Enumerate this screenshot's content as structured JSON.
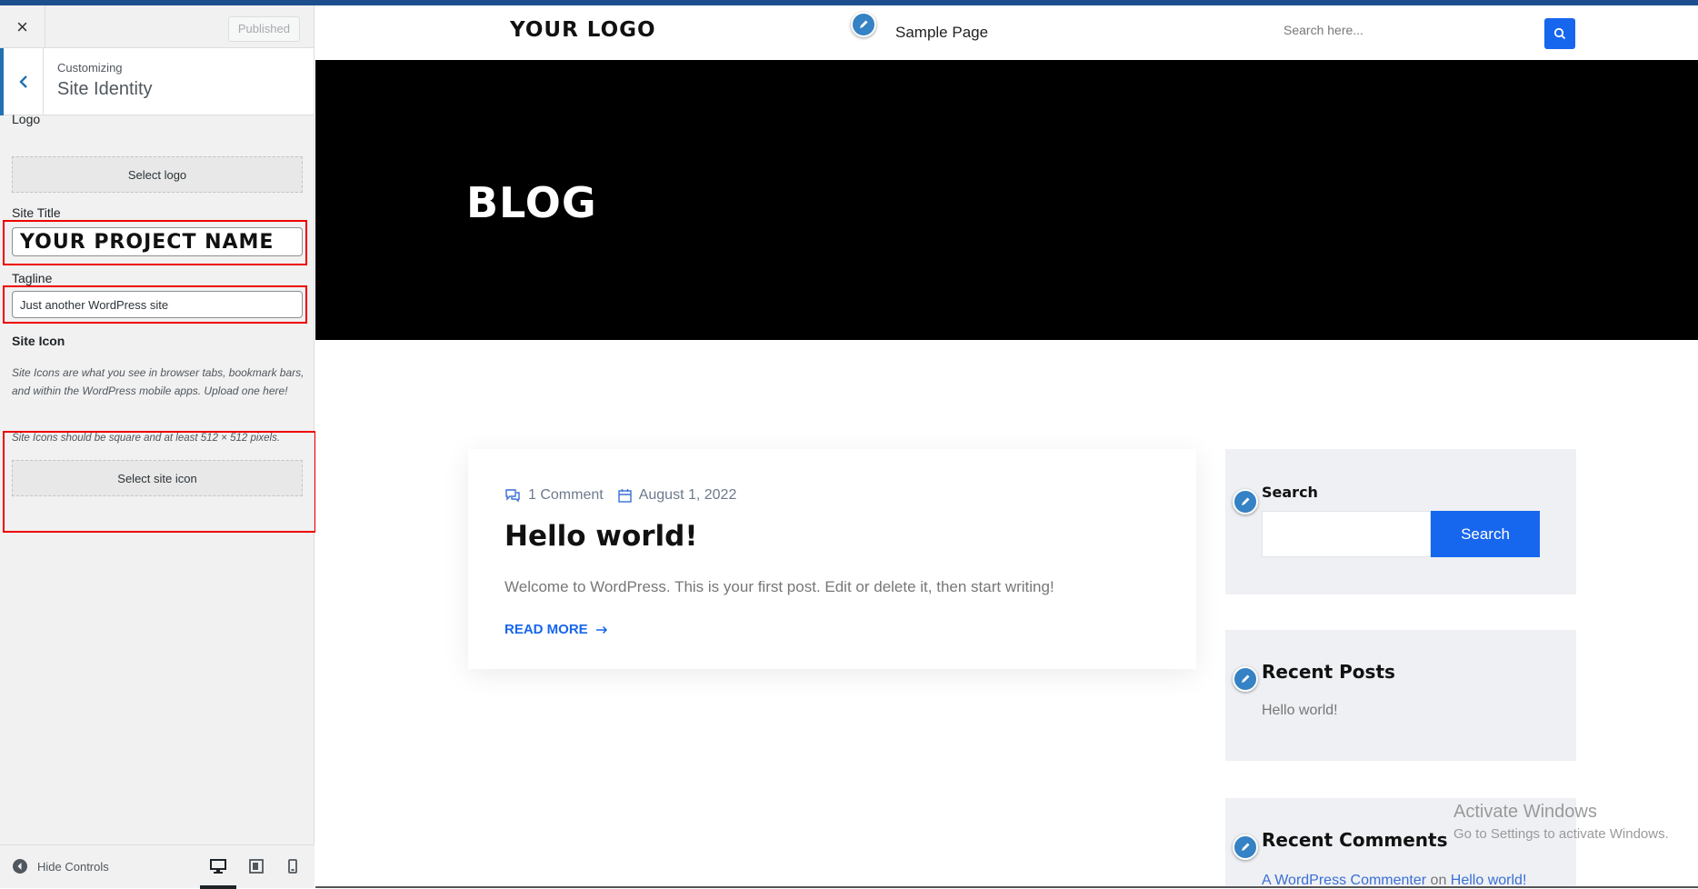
{
  "customizer": {
    "close_icon": "×",
    "publish_label": "Published",
    "section": {
      "breadcrumb": "Customizing",
      "title": "Site Identity"
    },
    "logo": {
      "label": "Logo",
      "button": "Select logo"
    },
    "site_title": {
      "label": "Site Title",
      "value": "YOUR PROJECT NAME"
    },
    "tagline": {
      "label": "Tagline",
      "value": "Just another WordPress site"
    },
    "site_icon": {
      "label": "Site Icon",
      "description": "Site Icons are what you see in browser tabs, bookmark bars, and within the WordPress mobile apps. Upload one here!",
      "note": "Site Icons should be square and at least 512 × 512 pixels.",
      "button": "Select site icon"
    },
    "footer": {
      "hide_controls": "Hide Controls",
      "devices": [
        "desktop-icon",
        "tablet-icon",
        "mobile-icon"
      ],
      "active_device": "desktop"
    },
    "highlight_color": "#ee0000"
  },
  "preview": {
    "header": {
      "logo": "YOUR LOGO",
      "nav": [
        "Sample Page"
      ],
      "search_placeholder": "Search here..."
    },
    "hero": {
      "title": "BLOG"
    },
    "post": {
      "comments": "1 Comment",
      "date": "August 1, 2022",
      "title": "Hello world!",
      "excerpt": "Welcome to WordPress. This is your first post. Edit or delete it, then start writing!",
      "read_more": "READ MORE"
    },
    "sidebar": {
      "search_widget": {
        "title": "Search",
        "button": "Search"
      },
      "recent_posts": {
        "title": "Recent Posts",
        "items": [
          "Hello world!"
        ]
      },
      "recent_comments": {
        "title": "Recent Comments",
        "commenter": "A WordPress Commenter",
        "on": "on",
        "post": "Hello world!"
      }
    },
    "accent_color": "#1766ee"
  },
  "windows_watermark": {
    "line1": "Activate Windows",
    "line2": "Go to Settings to activate Windows."
  }
}
